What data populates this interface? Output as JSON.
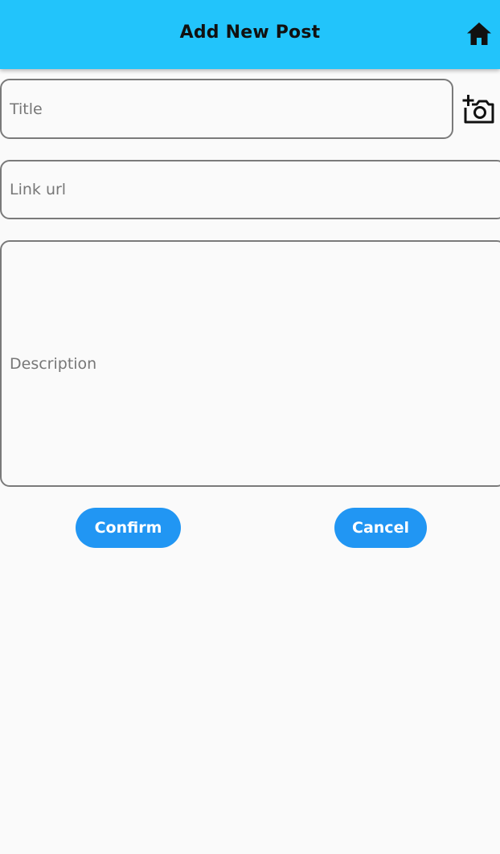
{
  "app_bar": {
    "title": "Add New Post",
    "home_icon": "home-icon",
    "background_color": "#22c4fb"
  },
  "form": {
    "title_field": {
      "placeholder": "Title",
      "value": ""
    },
    "add_photo_icon": "add-a-photo-icon",
    "link_field": {
      "placeholder": "Link url",
      "value": ""
    },
    "description_field": {
      "placeholder": "Description",
      "value": ""
    }
  },
  "actions": {
    "confirm_label": "Confirm",
    "cancel_label": "Cancel",
    "button_color": "#2196f3"
  }
}
